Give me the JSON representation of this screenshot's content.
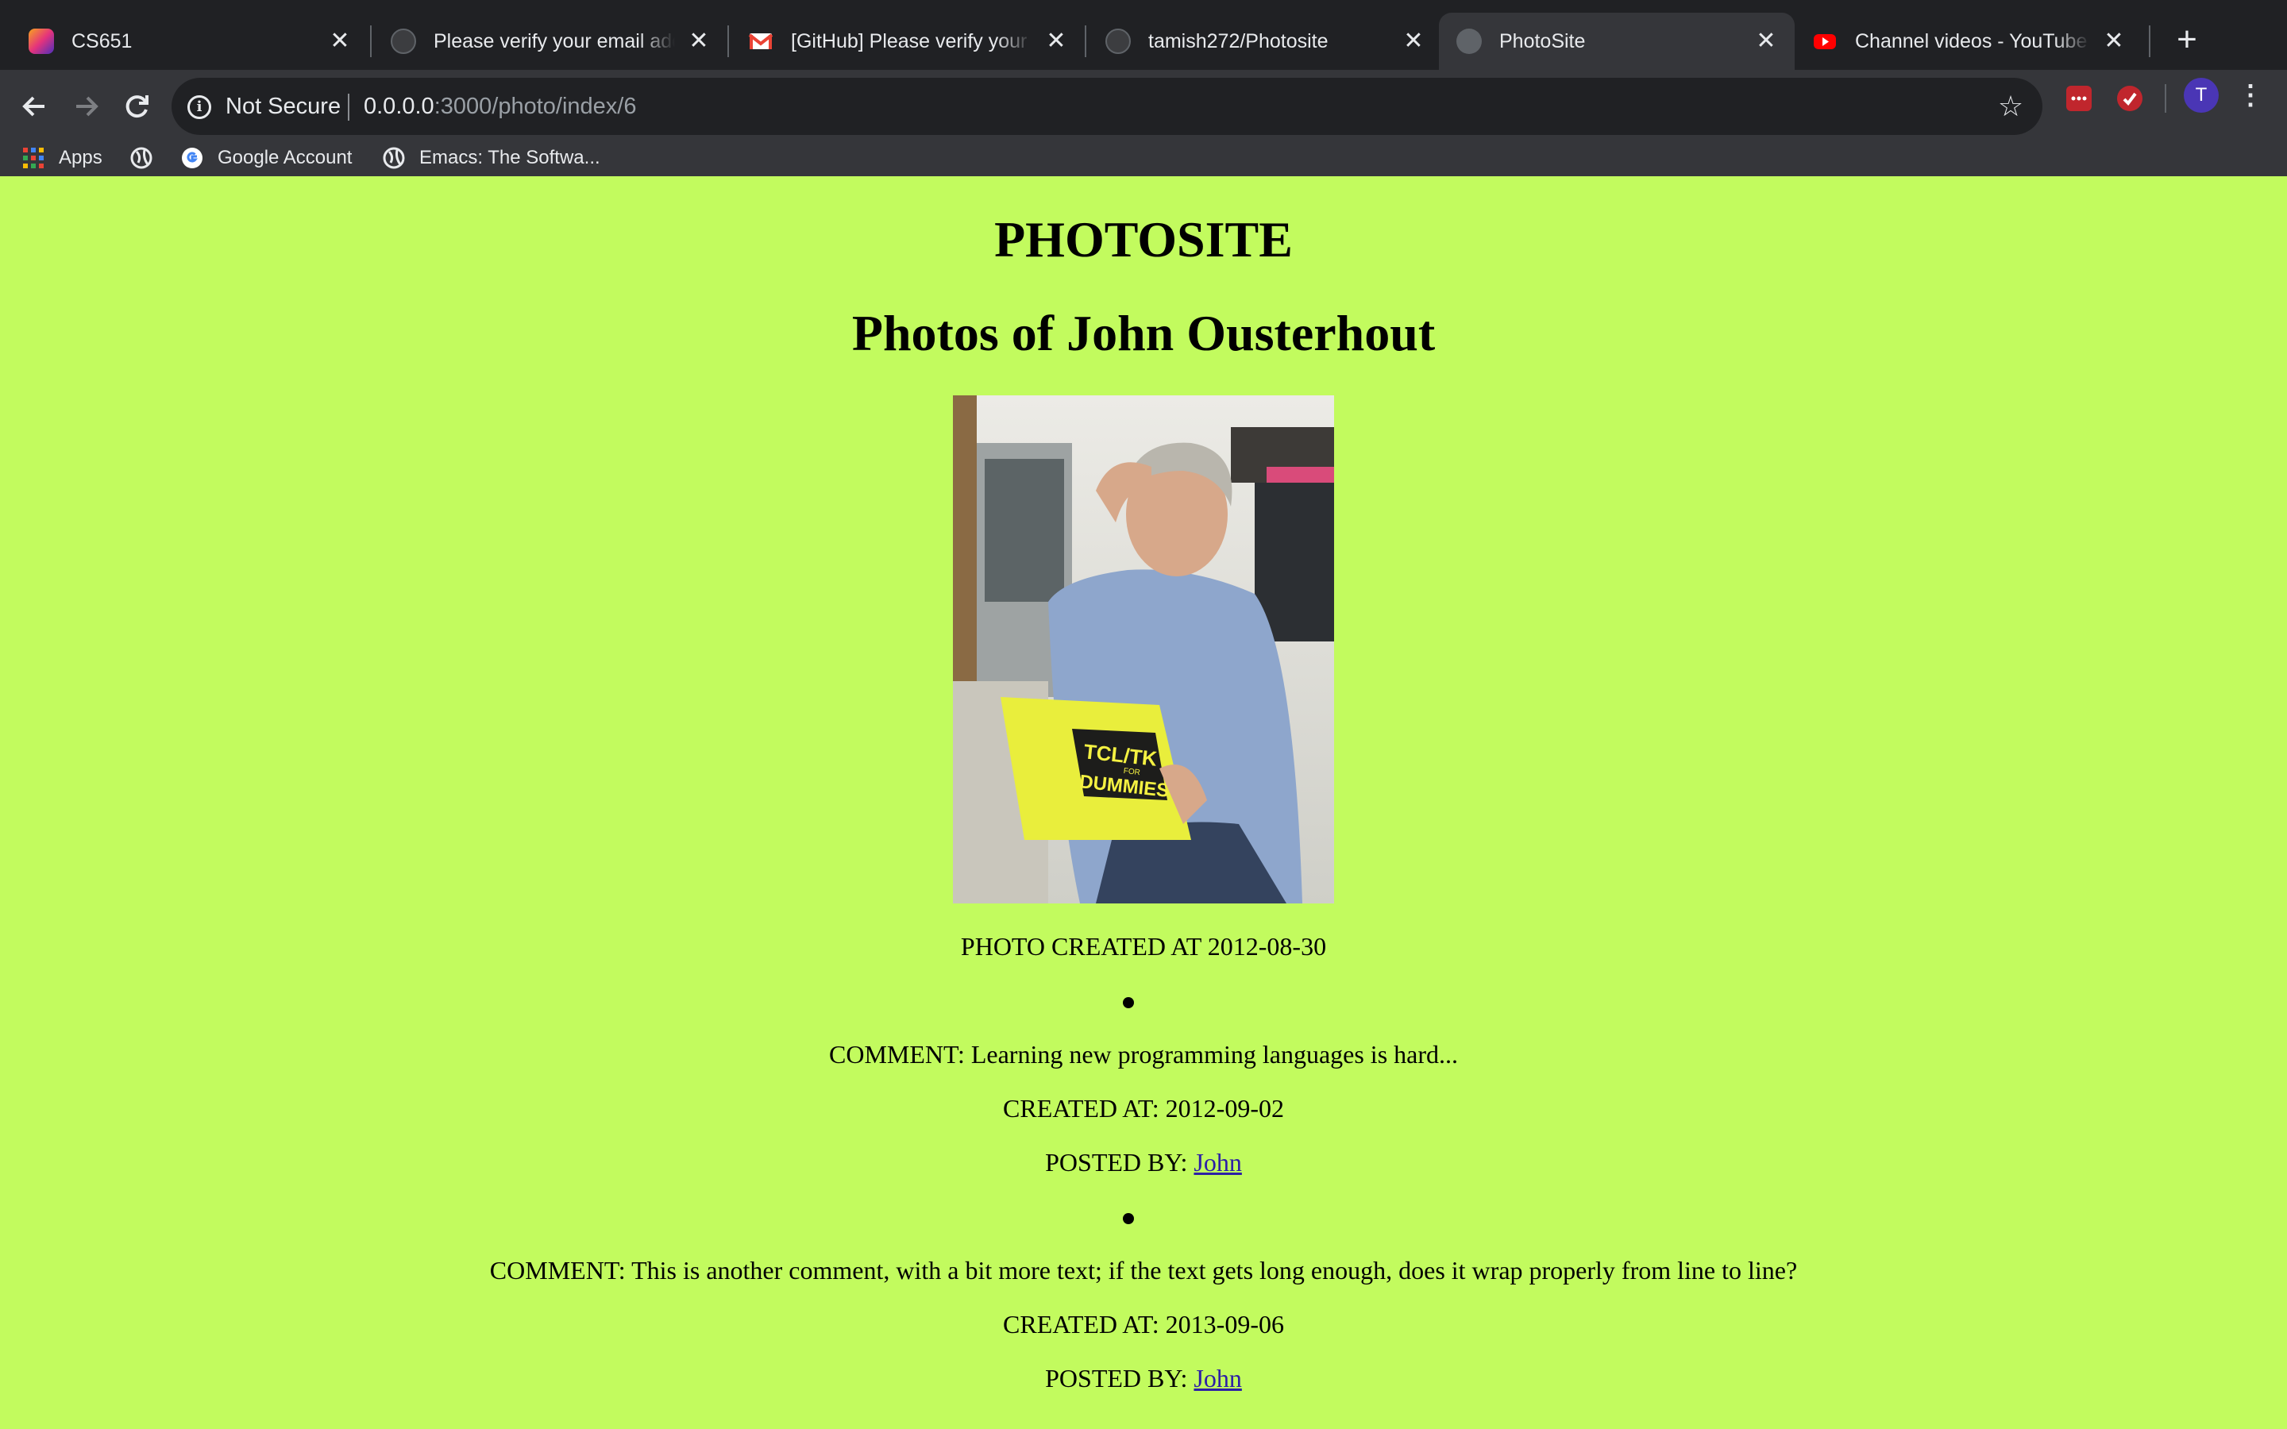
{
  "browser": {
    "tabs": [
      {
        "title": "CS651",
        "favicon": "leetcode-icon",
        "active": false
      },
      {
        "title": "Please verify your email address",
        "favicon": "github-icon",
        "active": false
      },
      {
        "title": "[GitHub] Please verify your email",
        "favicon": "gmail-icon",
        "active": false
      },
      {
        "title": "tamish272/Photosite",
        "favicon": "github-icon",
        "active": false
      },
      {
        "title": "PhotoSite",
        "favicon": "globe-icon",
        "active": true
      },
      {
        "title": "Channel videos - YouTube Studio",
        "favicon": "youtube-icon",
        "active": false
      }
    ],
    "tab_close_glyph": "✕",
    "new_tab_glyph": "+",
    "security_label": "Not Secure",
    "url_host": "0.0.0.0",
    "url_path": ":3000/photo/index/6",
    "profile_initial": "T",
    "bookmarks": [
      {
        "label": "Apps",
        "icon": "apps-grid-icon"
      },
      {
        "label": "",
        "icon": "globe-icon"
      },
      {
        "label": "Google Account",
        "icon": "google-icon"
      },
      {
        "label": "Emacs: The Softwa...",
        "icon": "globe-icon"
      }
    ]
  },
  "page": {
    "site_title": "PHOTOSITE",
    "heading": "Photos of John Ousterhout",
    "photo_created": "PHOTO CREATED AT 2012-08-30",
    "comments": [
      {
        "comment": "COMMENT: Learning new programming languages is hard...",
        "created": "CREATED AT: 2012-09-02",
        "posted_by_label": "POSTED BY: ",
        "author": "John"
      },
      {
        "comment": "COMMENT: This is another comment, with a bit more text; if the text gets long enough, does it wrap properly from line to line?",
        "created": "CREATED AT: 2013-09-06",
        "posted_by_label": "POSTED BY: ",
        "author": "John"
      }
    ],
    "book_title_line1": "TCL/TK",
    "book_title_line2": "DUMMIES",
    "book_title_small": "FOR",
    "colors": {
      "background": "#c2fb5e",
      "link": "#2d1fa6",
      "tab_strip": "#202124",
      "toolbar": "#35363a"
    }
  }
}
